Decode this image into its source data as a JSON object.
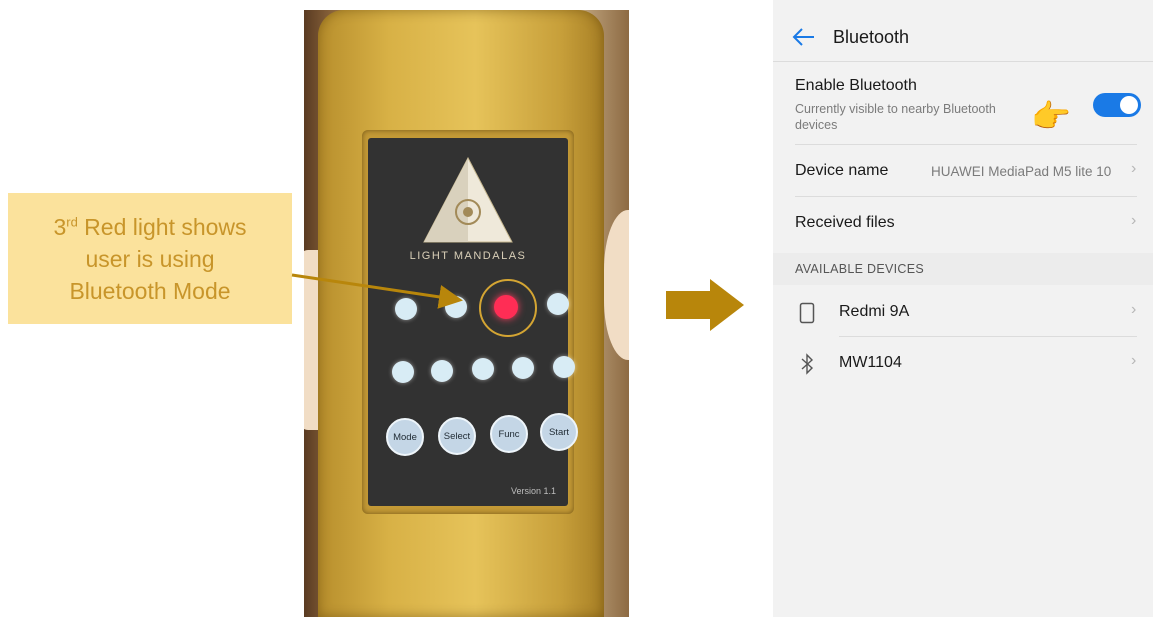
{
  "callout": {
    "line1_num": "3",
    "line1_sup": "rd",
    "line1_rest": " Red light shows",
    "line2": "user is using",
    "line3": "Bluetooth Mode"
  },
  "device": {
    "brand": "LIGHT MANDALAS",
    "buttons": [
      "Mode",
      "Select",
      "Func",
      "Start"
    ],
    "version": "Version 1.1",
    "active_light_index": 2
  },
  "phone": {
    "title": "Bluetooth",
    "enable": {
      "label": "Enable Bluetooth",
      "subtitle": "Currently visible to nearby Bluetooth devices",
      "enabled": true
    },
    "device_name": {
      "label": "Device name",
      "value": "HUAWEI MediaPad M5 lite 10"
    },
    "received_files": {
      "label": "Received files"
    },
    "section_header": "AVAILABLE DEVICES",
    "available_devices": [
      {
        "name": "Redmi 9A",
        "icon": "phone-icon"
      },
      {
        "name": "MW1104",
        "icon": "bluetooth-icon"
      }
    ]
  },
  "colors": {
    "accent_gold": "#b8860b",
    "callout_bg": "#fbe29c",
    "callout_text": "#c8952a",
    "toggle_blue": "#1a7ae6",
    "active_light": "#ff2d55"
  }
}
